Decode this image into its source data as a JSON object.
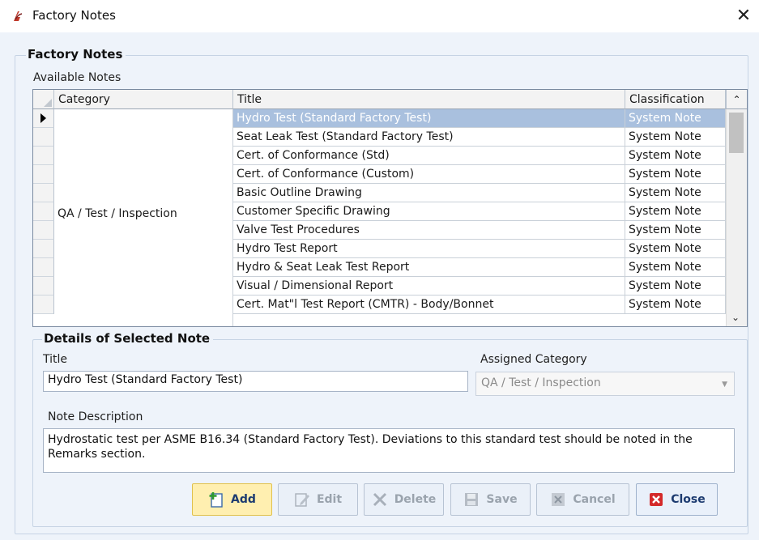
{
  "window": {
    "title": "Factory Notes",
    "close_glyph": "✕"
  },
  "group_main": {
    "label": "Factory Notes"
  },
  "available_label": "Available Notes",
  "grid": {
    "columns": [
      "Category",
      "Title",
      "Classification"
    ],
    "category_value": "QA / Test / Inspection",
    "rows": [
      {
        "title": "Hydro Test (Standard Factory Test)",
        "classification": "System Note"
      },
      {
        "title": "Seat Leak Test (Standard Factory Test)",
        "classification": "System Note"
      },
      {
        "title": "Cert. of Conformance (Std)",
        "classification": "System Note"
      },
      {
        "title": "Cert. of Conformance (Custom)",
        "classification": "System Note"
      },
      {
        "title": "Basic Outline Drawing",
        "classification": "System Note"
      },
      {
        "title": "Customer Specific Drawing",
        "classification": "System Note"
      },
      {
        "title": "Valve Test Procedures",
        "classification": "System Note"
      },
      {
        "title": "Hydro Test Report",
        "classification": "System Note"
      },
      {
        "title": "Hydro & Seat Leak Test Report",
        "classification": "System Note"
      },
      {
        "title": "Visual / Dimensional Report",
        "classification": "System Note"
      },
      {
        "title": "Cert. Mat\"l Test Report (CMTR) - Body/Bonnet",
        "classification": "System Note"
      }
    ],
    "selected_index": 0
  },
  "details": {
    "group_label": "Details of Selected Note",
    "title_label": "Title",
    "title_value": "Hydro Test (Standard Factory Test)",
    "category_label": "Assigned Category",
    "category_value": "QA / Test / Inspection",
    "description_label": "Note Description",
    "description_value": "Hydrostatic test per ASME B16.34 (Standard Factory Test).  Deviations to this standard test should be noted in the Remarks section."
  },
  "buttons": {
    "add": "Add",
    "edit": "Edit",
    "delete": "Delete",
    "save": "Save",
    "cancel": "Cancel",
    "close": "Close"
  },
  "colors": {
    "selection": "#a9c0de",
    "window_bg": "#eef3fa",
    "add_bg": "#ffefb0",
    "close_icon": "#d42a2a"
  }
}
